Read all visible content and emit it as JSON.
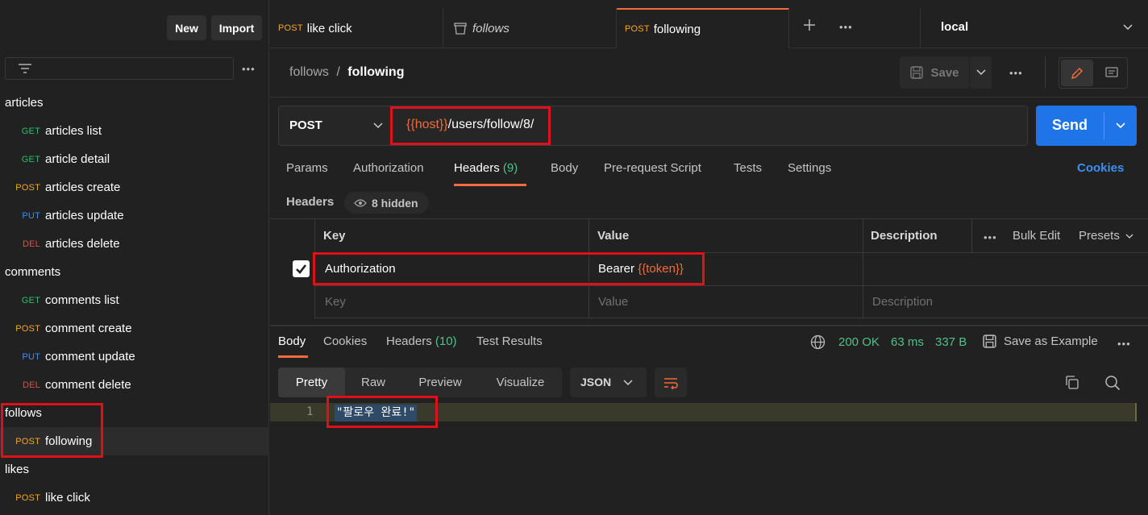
{
  "sidebar": {
    "new_label": "New",
    "import_label": "Import",
    "folders": [
      {
        "name": "articles",
        "items": [
          {
            "method": "GET",
            "label": "articles list"
          },
          {
            "method": "GET",
            "label": "article detail"
          },
          {
            "method": "POST",
            "label": "articles create"
          },
          {
            "method": "PUT",
            "label": "articles update"
          },
          {
            "method": "DEL",
            "label": "articles delete"
          }
        ]
      },
      {
        "name": "comments",
        "items": [
          {
            "method": "GET",
            "label": "comments list"
          },
          {
            "method": "POST",
            "label": "comment create"
          },
          {
            "method": "PUT",
            "label": "comment update"
          },
          {
            "method": "DEL",
            "label": "comment delete"
          }
        ]
      },
      {
        "name": "follows",
        "items": [
          {
            "method": "POST",
            "label": "following"
          }
        ]
      },
      {
        "name": "likes",
        "items": [
          {
            "method": "POST",
            "label": "like click"
          }
        ]
      }
    ]
  },
  "tabs": [
    {
      "method": "POST",
      "label": "like click"
    },
    {
      "method": "",
      "label": "follows"
    },
    {
      "method": "POST",
      "label": "following"
    }
  ],
  "environment": "local",
  "breadcrumb": {
    "parent": "follows",
    "sep": "/",
    "current": "following"
  },
  "save_label": "Save",
  "request": {
    "method": "POST",
    "url_var": "{{host}}",
    "url_path": "/users/follow/8/",
    "send_label": "Send"
  },
  "request_tabs": {
    "params": "Params",
    "authorization": "Authorization",
    "headers": "Headers",
    "headers_count": "(9)",
    "body": "Body",
    "prerequest": "Pre-request Script",
    "tests": "Tests",
    "settings": "Settings",
    "cookies": "Cookies"
  },
  "headers_section": {
    "title": "Headers",
    "hidden_label": "8 hidden",
    "columns": {
      "key": "Key",
      "value": "Value",
      "description": "Description"
    },
    "bulk_edit": "Bulk Edit",
    "presets": "Presets",
    "rows": [
      {
        "key": "Authorization",
        "value_prefix": "Bearer ",
        "value_var": "{{token}}"
      }
    ],
    "placeholder": {
      "key": "Key",
      "value": "Value",
      "description": "Description"
    }
  },
  "response": {
    "tabs": {
      "body": "Body",
      "cookies": "Cookies",
      "headers": "Headers",
      "headers_count": "(10)",
      "test_results": "Test Results"
    },
    "status": "200 OK",
    "time": "63 ms",
    "size": "337 B",
    "save_example": "Save as Example",
    "views": {
      "pretty": "Pretty",
      "raw": "Raw",
      "preview": "Preview",
      "visualize": "Visualize"
    },
    "format": "JSON",
    "line_number": "1",
    "body_line": "\"팔로우 완료!\""
  },
  "colors": {
    "accent_orange": "#f26b3a",
    "send_blue": "#1f74e8",
    "status_green": "#4cc38a",
    "highlight_red": "#e0101a"
  }
}
